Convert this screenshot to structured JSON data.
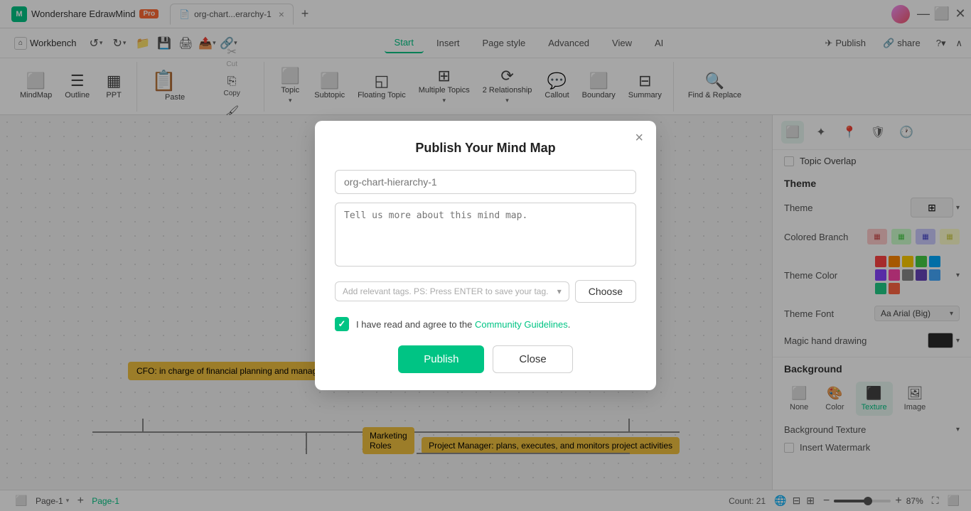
{
  "app": {
    "name": "Wondershare EdrawMind",
    "badge": "Pro",
    "tab_name": "org-chart...erarchy-1",
    "window_title": "org-chart...erarchy-1"
  },
  "titlebar": {
    "logo_letter": "M",
    "workbench_label": "Workbench",
    "undo_label": "↺",
    "redo_label": "↻",
    "add_tab": "+",
    "tab_close": "×"
  },
  "menubar": {
    "workbench_label": "Workbench",
    "nav_tabs": [
      "Start",
      "Insert",
      "Page style",
      "Advanced",
      "View",
      "AI"
    ],
    "active_tab": "Start",
    "publish_label": "Publish",
    "share_label": "share",
    "help_label": "?",
    "collapse_label": "∧"
  },
  "ribbon": {
    "groups": [
      {
        "items": [
          {
            "id": "mindmap",
            "label": "MindMap",
            "icon": "⬜"
          },
          {
            "id": "outline",
            "label": "Outline",
            "icon": "☰"
          },
          {
            "id": "ppt",
            "label": "PPT",
            "icon": "⬛"
          }
        ]
      },
      {
        "items": [
          {
            "id": "paste",
            "label": "Paste",
            "icon": "📋",
            "has_arrow": true
          },
          {
            "id": "cut",
            "label": "Cut",
            "icon": "✂",
            "disabled": true
          },
          {
            "id": "copy",
            "label": "Copy",
            "icon": "⎘",
            "disabled": false
          },
          {
            "id": "format-painter",
            "label": "Format Painter",
            "icon": "🖌",
            "disabled": false
          }
        ]
      },
      {
        "items": [
          {
            "id": "topic",
            "label": "Topic",
            "icon": "⬜",
            "has_arrow": true
          },
          {
            "id": "subtopic",
            "label": "Subtopic",
            "icon": "⬜"
          },
          {
            "id": "floating-topic",
            "label": "Floating Topic",
            "icon": "◱"
          },
          {
            "id": "multiple-topics",
            "label": "Multiple Topics",
            "icon": "⊞",
            "has_arrow": true
          },
          {
            "id": "relationship",
            "label": "Relationship",
            "icon": "⟳",
            "has_arrow": true
          },
          {
            "id": "callout",
            "label": "Callout",
            "icon": "💬"
          },
          {
            "id": "boundary",
            "label": "Boundary",
            "icon": "⬜"
          },
          {
            "id": "summary",
            "label": "Summary",
            "icon": "⊟"
          }
        ]
      },
      {
        "items": [
          {
            "id": "find-replace",
            "label": "Find & Replace",
            "icon": "🔍"
          }
        ]
      }
    ]
  },
  "modal": {
    "title": "Publish Your Mind Map",
    "close_icon": "×",
    "name_placeholder": "org-chart-hierarchy-1",
    "description_placeholder": "Tell us more about this mind map.",
    "tags_placeholder": "Add relevant tags. PS: Press ENTER to save your tag.",
    "choose_btn_label": "Choose",
    "agree_text": "I have read and agree to the",
    "community_link_text": "Community Guidelines",
    "period": ".",
    "publish_btn_label": "Publish",
    "close_btn_label": "Close"
  },
  "right_panel": {
    "topic_overlap_label": "Topic Overlap",
    "theme_section_label": "Theme",
    "theme_label": "Theme",
    "colored_branch_label": "Colored Branch",
    "theme_color_label": "Theme Color",
    "theme_font_label": "Theme Font",
    "theme_font_value": "Aa Arial (Big)",
    "magic_hand_label": "Magic hand drawing",
    "background_section_label": "Background",
    "bg_tabs": [
      "None",
      "Color",
      "Texture",
      "Image"
    ],
    "bg_active_tab": "Texture",
    "bg_texture_label": "Background Texture",
    "insert_watermark_label": "Insert Watermark",
    "theme_colors": [
      "#ff4444",
      "#ff8800",
      "#ffcc00",
      "#44cc44",
      "#00aaff",
      "#8844ff",
      "#ff44aa",
      "#888888",
      "#6644bb",
      "#44aaff",
      "#22cc88",
      "#ff6644"
    ]
  },
  "canvas": {
    "node_cfo": "CFO: in charge of financial planning and management",
    "node_marketing": "Marketing Roles",
    "node_pm": "Project Manager: plans, executes, and monitors project activities"
  },
  "statusbar": {
    "page_label": "Page-1",
    "page_tab_active": "Page-1",
    "add_page": "+",
    "count_label": "Count: 21",
    "zoom_value": "87%"
  }
}
